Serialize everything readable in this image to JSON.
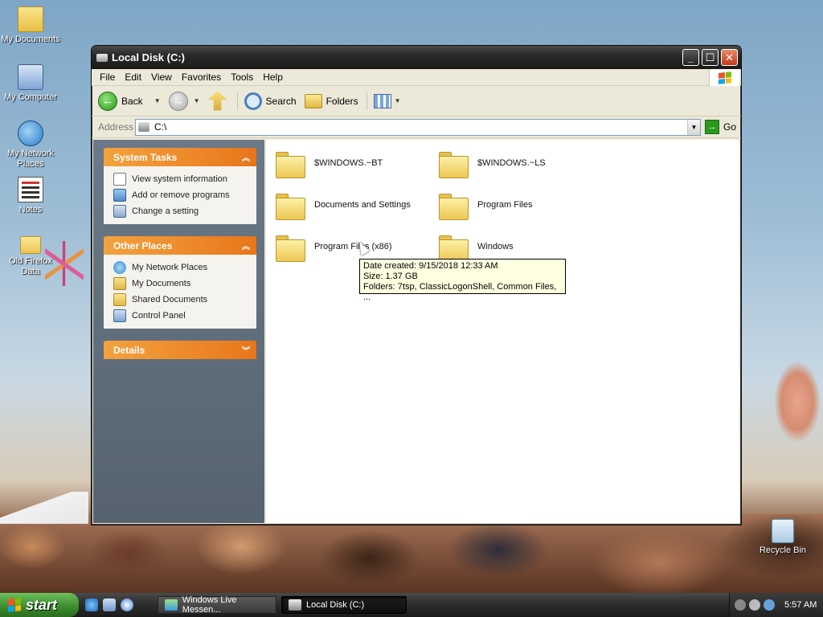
{
  "desktop": {
    "icons": [
      {
        "label": "My Documents"
      },
      {
        "label": "My Computer"
      },
      {
        "label": "My Network Places"
      },
      {
        "label": "Notes"
      },
      {
        "label": "Old Firefox Data"
      },
      {
        "label": "Recycle Bin"
      }
    ]
  },
  "window": {
    "title": "Local Disk (C:)",
    "menu": [
      "File",
      "Edit",
      "View",
      "Favorites",
      "Tools",
      "Help"
    ],
    "toolbar": {
      "back": "Back",
      "search": "Search",
      "folders": "Folders"
    },
    "address": {
      "label": "Address",
      "value": "C:\\",
      "go": "Go"
    },
    "taskpane": {
      "system_tasks": {
        "title": "System Tasks",
        "items": [
          "View system information",
          "Add or remove programs",
          "Change a setting"
        ]
      },
      "other_places": {
        "title": "Other Places",
        "items": [
          "My Network Places",
          "My Documents",
          "Shared Documents",
          "Control Panel"
        ]
      },
      "details": {
        "title": "Details"
      }
    },
    "files": [
      "$WINDOWS.~BT",
      "$WINDOWS.~LS",
      "Documents and Settings",
      "Program Files",
      "Program Files (x86)",
      "Windows"
    ],
    "tooltip": {
      "line1": "Date created: 9/15/2018 12:33 AM",
      "line2": "Size: 1.37 GB",
      "line3": "Folders: 7tsp, ClassicLogonShell, Common Files, ..."
    }
  },
  "taskbar": {
    "start": "start",
    "tasks": [
      "Windows Live Messen...",
      "Local Disk (C:)"
    ],
    "clock": "5:57 AM"
  }
}
